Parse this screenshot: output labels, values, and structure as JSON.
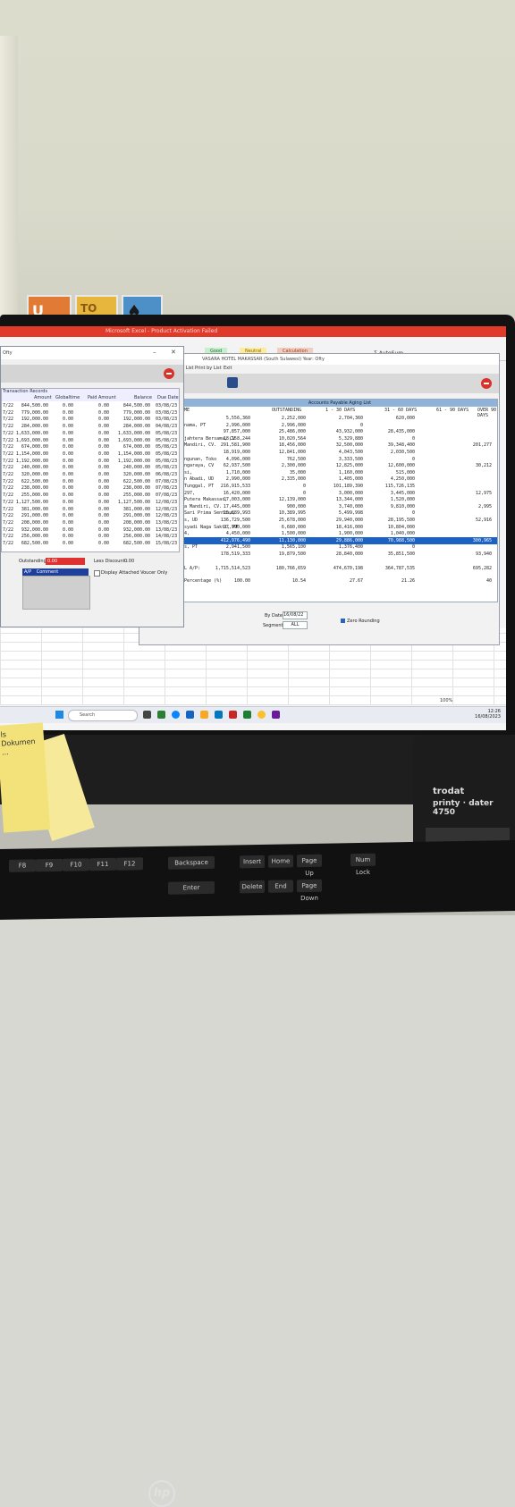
{
  "scene": {
    "wall_art": [
      "U",
      "TO",
      "♠"
    ],
    "monitor_logo": "hp",
    "stamp": {
      "brand": "trodat",
      "model": "printy · dater 4750"
    },
    "sticky_note": "ls\nDokumen\n...",
    "keyboard_keys": [
      "F8",
      "F9",
      "F10",
      "F11",
      "F12",
      "Backspace",
      "Insert",
      "Home",
      "Page Up",
      "Num Lock",
      "Delete",
      "End",
      "Page Down",
      "Enter"
    ]
  },
  "excel": {
    "title": "Microsoft Excel - Product Activation Failed",
    "styles": [
      "Good",
      "Neutral",
      "Calculation"
    ],
    "autosum": "Σ AutoSum"
  },
  "aging_window": {
    "title": "VASARA HOTEL MAKASSAR (South Sulawesi) Year: Ofty",
    "menu": [
      "Ex List",
      "Print by List",
      "Exit"
    ],
    "report_title": "Accounts Payable Aging List",
    "columns": [
      "ME",
      "OUTSTANDING",
      "1 - 30 DAYS",
      "31 - 60 DAYS",
      "61 - 90 DAYS",
      "OVER 90 DAYS"
    ],
    "rows": [
      {
        "name": "",
        "o": "5,556,360",
        "a": "2,252,000",
        "b": "2,704,360",
        "c": "620,000",
        "d": ""
      },
      {
        "name": "nama, PT",
        "o": "2,996,000",
        "a": "2,996,000",
        "b": "0",
        "c": "",
        "d": ""
      },
      {
        "name": "",
        "o": "97,857,000",
        "a": "25,486,000",
        "b": "43,932,000",
        "c": "28,435,000",
        "d": ""
      },
      {
        "name": "jahtera Bersama, CV",
        "o": "18,158,244",
        "a": "10,020,564",
        "b": "5,329,880",
        "c": "0",
        "d": ""
      },
      {
        "name": "Mandiri, CV.",
        "o": "291,581,900",
        "a": "18,456,000",
        "b": "32,500,000",
        "c": "39,348,400",
        "d": "201,277"
      },
      {
        "name": "",
        "o": "18,919,000",
        "a": "12,841,000",
        "b": "4,043,500",
        "c": "2,030,500",
        "d": ""
      },
      {
        "name": "ngunan, Toko",
        "o": "4,096,000",
        "a": "762,500",
        "b": "3,333,500",
        "c": "0",
        "d": ""
      },
      {
        "name": "ngaraya, CV",
        "o": "62,937,500",
        "a": "2,300,000",
        "b": "12,825,000",
        "c": "12,600,000",
        "d": "30,212"
      },
      {
        "name": "si,",
        "o": "1,710,000",
        "a": "35,000",
        "b": "1,160,000",
        "c": "515,000",
        "d": ""
      },
      {
        "name": "n Abadi, UD",
        "o": "2,990,000",
        "a": "2,335,000",
        "b": "1,405,000",
        "c": "4,250,000",
        "d": ""
      },
      {
        "name": "Tunggal, PT",
        "o": "216,915,533",
        "a": "0",
        "b": "101,189,390",
        "c": "115,726,135",
        "d": ""
      },
      {
        "name": "297,",
        "o": "16,420,000",
        "a": "0",
        "b": "3,000,000",
        "c": "3,445,000",
        "d": "12,975"
      },
      {
        "name": "Putera Makassar,",
        "o": "27,003,000",
        "a": "12,139,000",
        "b": "13,344,000",
        "c": "1,520,000",
        "d": ""
      },
      {
        "name": "a Mandiri, CV.",
        "o": "17,445,000",
        "a": "900,000",
        "b": "3,740,000",
        "c": "9,810,000",
        "d": "2,995"
      },
      {
        "name": "Sari Prima Sentosa,",
        "o": "15,889,993",
        "a": "10,389,995",
        "b": "5,499,998",
        "c": "0",
        "d": ""
      },
      {
        "name": "s, UD",
        "o": "136,729,500",
        "a": "25,678,000",
        "b": "29,940,000",
        "c": "28,195,500",
        "d": "52,916"
      },
      {
        "name": "syadi Naga Sakti, PT",
        "o": "27,990,000",
        "a": "6,680,000",
        "b": "18,416,000",
        "c": "10,804,000",
        "d": ""
      },
      {
        "name": "4,",
        "o": "4,450,000",
        "a": "1,500,000",
        "b": "1,900,000",
        "c": "1,040,000",
        "d": ""
      },
      {
        "name": "",
        "o": "412,976,490",
        "a": "11,130,000",
        "b": "29,886,000",
        "c": "70,988,500",
        "d": "300,965"
      },
      {
        "name": "s, PT",
        "o": "2,941,500",
        "a": "1,565,100",
        "b": "1,376,400",
        "c": "0",
        "d": ""
      },
      {
        "name": "",
        "o": "178,519,333",
        "a": "19,879,500",
        "b": "28,840,000",
        "c": "35,851,500",
        "d": "93,940"
      }
    ],
    "total_label": "L A/P:",
    "total": {
      "o": "1,715,514,523",
      "a": "180,766,659",
      "b": "474,670,198",
      "c": "364,787,535",
      "d": "695,282"
    },
    "percent_label": "Percentage (%)",
    "percent": {
      "o": "100.00",
      "a": "10.54",
      "b": "27.67",
      "c": "21.26",
      "d": "40"
    },
    "by_date_label": "By Date:",
    "by_date": "16/08/22",
    "segment_label": "Segment:",
    "segment": "ALL",
    "zero_rounding": "Zero Rounding"
  },
  "transaction_window": {
    "title": "Ofty",
    "section": "Transaction Records",
    "columns": [
      "Amount",
      "Globaltime",
      "Paid Amount",
      "Balance",
      "Due Date"
    ],
    "rows": [
      {
        "d": "7/22",
        "amt": "844,500.00",
        "g": "0.00",
        "p": "0.00",
        "bal": "844,500.00",
        "due": "03/08/23"
      },
      {
        "d": "7/22",
        "amt": "779,000.00",
        "g": "0.00",
        "p": "0.00",
        "bal": "779,000.00",
        "due": "03/08/23"
      },
      {
        "d": "7/22",
        "amt": "192,000.00",
        "g": "0.00",
        "p": "0.00",
        "bal": "192,000.00",
        "due": "03/08/23"
      },
      {
        "d": "7/22",
        "amt": "284,000.00",
        "g": "0.00",
        "p": "0.00",
        "bal": "284,000.00",
        "due": "04/08/23"
      },
      {
        "d": "7/22",
        "amt": "1,633,000.00",
        "g": "0.00",
        "p": "0.00",
        "bal": "1,633,000.00",
        "due": "05/08/23"
      },
      {
        "d": "7/22",
        "amt": "1,693,000.00",
        "g": "0.00",
        "p": "0.00",
        "bal": "1,693,000.00",
        "due": "05/08/23"
      },
      {
        "d": "7/22",
        "amt": "674,000.00",
        "g": "0.00",
        "p": "0.00",
        "bal": "674,000.00",
        "due": "05/08/23"
      },
      {
        "d": "7/22",
        "amt": "1,154,000.00",
        "g": "0.00",
        "p": "0.00",
        "bal": "1,154,000.00",
        "due": "05/08/23"
      },
      {
        "d": "7/22",
        "amt": "1,192,000.00",
        "g": "0.00",
        "p": "0.00",
        "bal": "1,192,000.00",
        "due": "05/08/23"
      },
      {
        "d": "7/22",
        "amt": "240,000.00",
        "g": "0.00",
        "p": "0.00",
        "bal": "240,000.00",
        "due": "05/08/23"
      },
      {
        "d": "7/22",
        "amt": "320,000.00",
        "g": "0.00",
        "p": "0.00",
        "bal": "320,000.00",
        "due": "06/08/23"
      },
      {
        "d": "7/22",
        "amt": "622,500.00",
        "g": "0.00",
        "p": "0.00",
        "bal": "622,500.00",
        "due": "07/08/23"
      },
      {
        "d": "7/22",
        "amt": "238,000.00",
        "g": "0.00",
        "p": "0.00",
        "bal": "238,000.00",
        "due": "07/08/23"
      },
      {
        "d": "7/22",
        "amt": "255,000.00",
        "g": "0.00",
        "p": "0.00",
        "bal": "255,000.00",
        "due": "07/08/23"
      },
      {
        "d": "7/22",
        "amt": "1,127,500.00",
        "g": "0.00",
        "p": "0.00",
        "bal": "1,127,500.00",
        "due": "12/08/23"
      },
      {
        "d": "7/22",
        "amt": "381,000.00",
        "g": "0.00",
        "p": "0.00",
        "bal": "381,000.00",
        "due": "12/08/23"
      },
      {
        "d": "7/22",
        "amt": "291,000.00",
        "g": "0.00",
        "p": "0.00",
        "bal": "291,000.00",
        "due": "12/08/23"
      },
      {
        "d": "7/22",
        "amt": "208,000.00",
        "g": "0.00",
        "p": "0.00",
        "bal": "208,000.00",
        "due": "13/08/23"
      },
      {
        "d": "7/22",
        "amt": "932,000.00",
        "g": "0.00",
        "p": "0.00",
        "bal": "932,000.00",
        "due": "13/08/23"
      },
      {
        "d": "7/22",
        "amt": "256,000.00",
        "g": "0.00",
        "p": "0.00",
        "bal": "256,000.00",
        "due": "14/08/23"
      },
      {
        "d": "7/22",
        "amt": "682,500.00",
        "g": "0.00",
        "p": "0.00",
        "bal": "682,500.00",
        "due": "15/08/23"
      }
    ],
    "outstanding_label": "Outstanding :",
    "outstanding": "0.00",
    "less_discount_label": "Less Discount :",
    "less_discount": "0.00",
    "display_voucher": "Display Attached Voucer Only",
    "ap_label": "A/P",
    "comment_label": "Comment"
  },
  "taskbar": {
    "search_placeholder": "Search",
    "zoom": "100%",
    "time": "12:26",
    "date": "16/08/2023"
  }
}
